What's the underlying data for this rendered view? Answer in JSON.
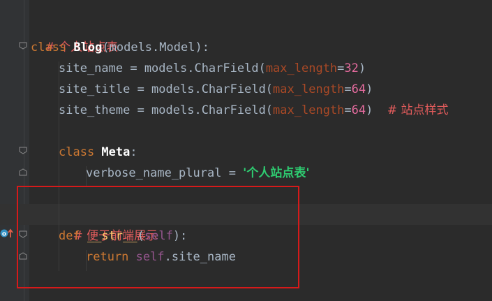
{
  "editor": {
    "lines": [
      {
        "comment": "# 个人站点表"
      },
      {
        "kw": "class ",
        "name": "Blog",
        "open": "(",
        "base": "models.Model",
        "close": "):"
      },
      {
        "var": "site_name = models.CharField(",
        "param": "max_length",
        "eq": "=",
        "num": "32",
        "end": ")"
      },
      {
        "var": "site_title = models.CharField(",
        "param": "max_length",
        "eq": "=",
        "num": "64",
        "end": ")"
      },
      {
        "var": "site_theme = models.CharField(",
        "param": "max_length",
        "eq": "=",
        "num": "64",
        "end": ")  ",
        "comment": "# 站点样式"
      },
      {},
      {
        "kw": "class ",
        "name": "Meta",
        "end": ":"
      },
      {
        "var": "verbose_name_plural = ",
        "str": "'个人站点表'"
      },
      {},
      {
        "comment": "# 便于前端展示"
      },
      {
        "kw": "def ",
        "name": "__str__",
        "open": "(",
        "self": "self",
        "close": "):"
      },
      {
        "kw": "return ",
        "self": "self",
        "rest": ".site_name"
      }
    ]
  },
  "colors": {
    "background": "#2b2b2b",
    "highlight_box": "#d61a1a",
    "keyword": "#cc7832",
    "comment": "#e05b5b"
  },
  "icons": {
    "override": "override-method-icon",
    "fold": "fold-marker-icon"
  }
}
